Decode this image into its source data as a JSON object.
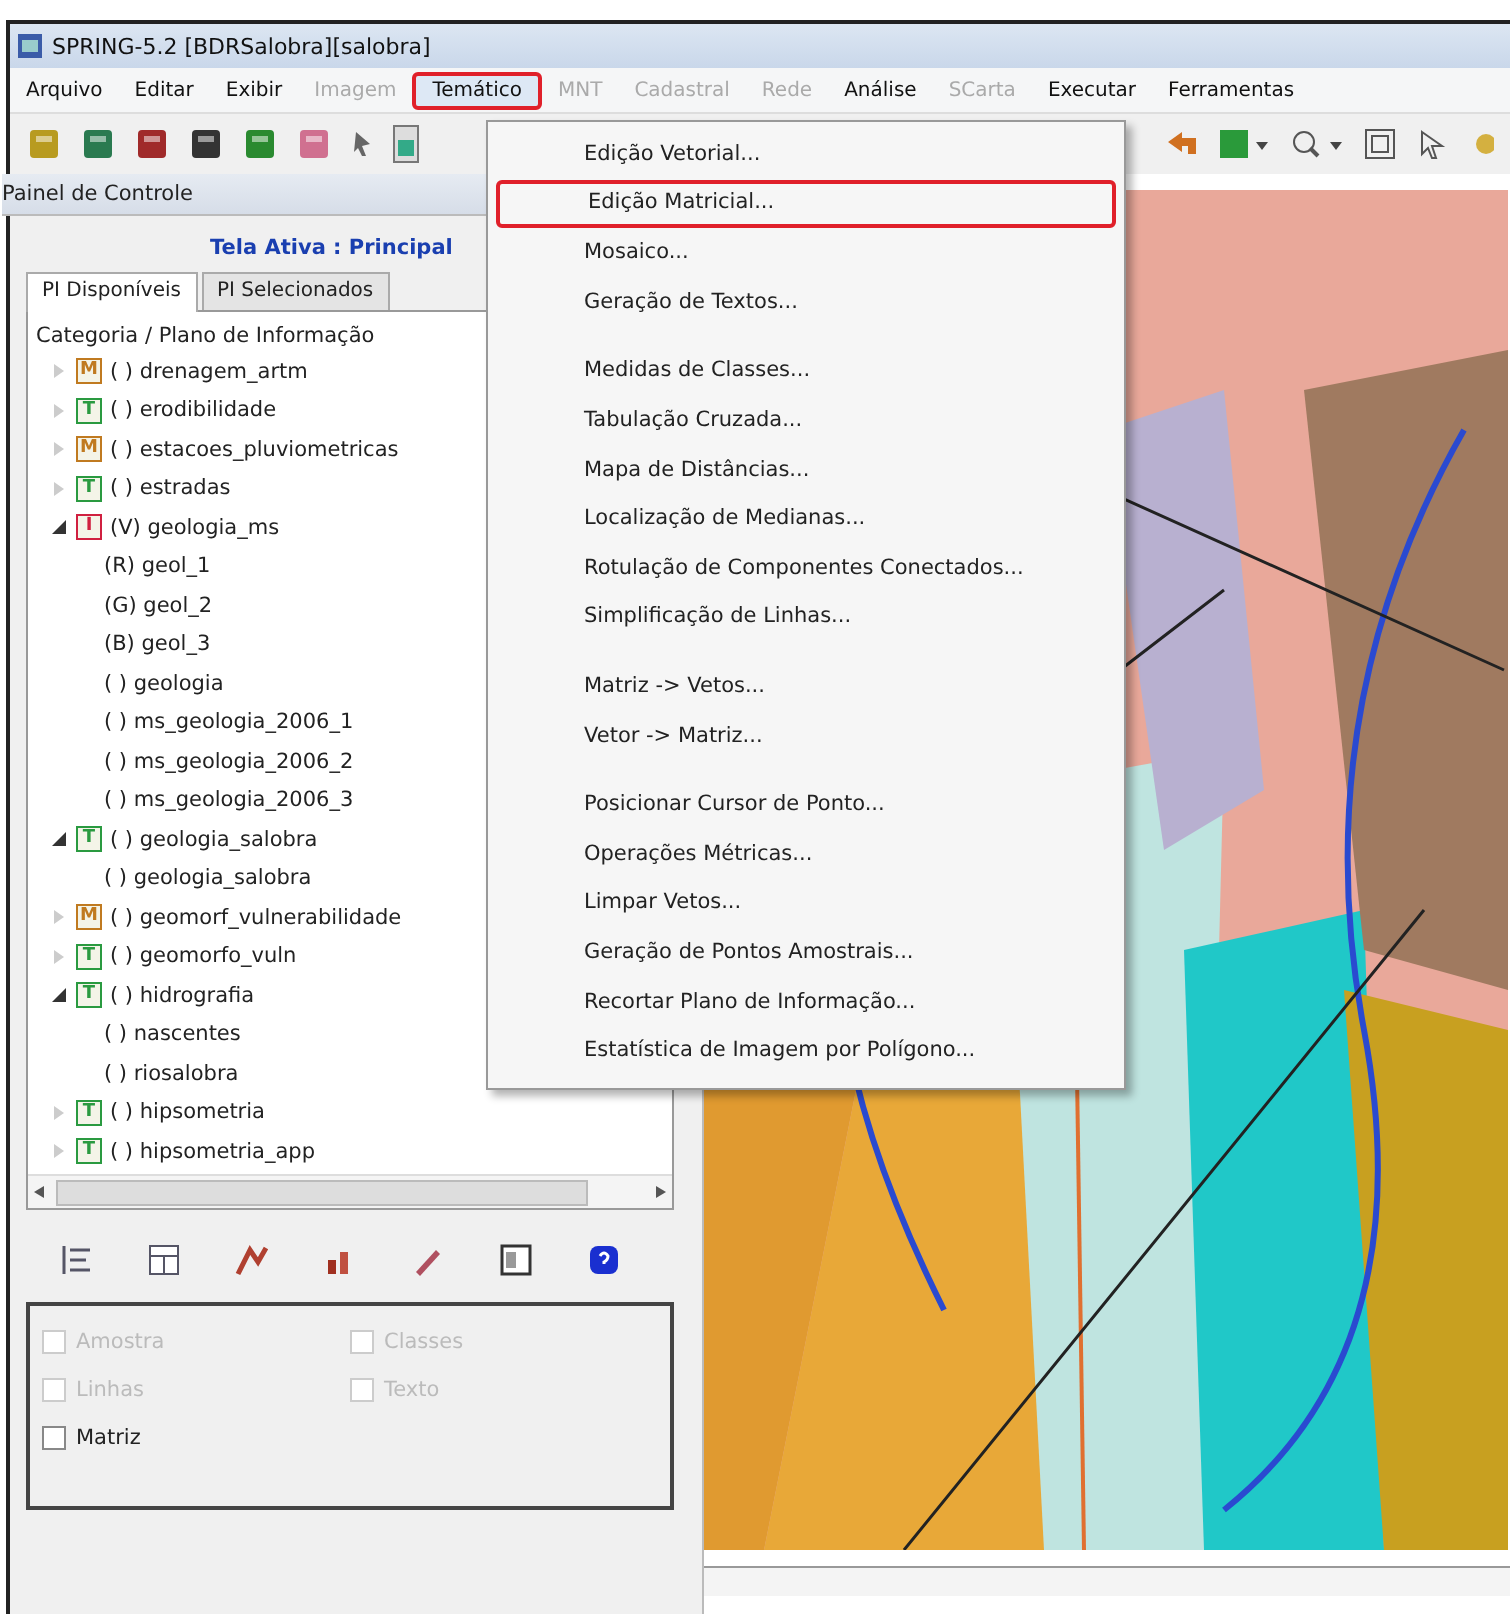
{
  "window": {
    "title": "SPRING-5.2 [BDRSalobra][salobra]"
  },
  "menu_bar": [
    {
      "label": "Arquivo",
      "disabled": false,
      "highlighted": false
    },
    {
      "label": "Editar",
      "disabled": false,
      "highlighted": false
    },
    {
      "label": "Exibir",
      "disabled": false,
      "highlighted": false
    },
    {
      "label": "Imagem",
      "disabled": true,
      "highlighted": false
    },
    {
      "label": "Temático",
      "disabled": false,
      "highlighted": true
    },
    {
      "label": "MNT",
      "disabled": true,
      "highlighted": false
    },
    {
      "label": "Cadastral",
      "disabled": true,
      "highlighted": false
    },
    {
      "label": "Rede",
      "disabled": true,
      "highlighted": false
    },
    {
      "label": "Análise",
      "disabled": false,
      "highlighted": false
    },
    {
      "label": "SCarta",
      "disabled": true,
      "highlighted": false
    },
    {
      "label": "Executar",
      "disabled": false,
      "highlighted": false
    },
    {
      "label": "Ferramentas",
      "disabled": false,
      "highlighted": false
    }
  ],
  "control_panel": {
    "title": "Painel de Controle",
    "active_screen": "Tela Ativa : Principal",
    "tabs": [
      {
        "label": "PI Disponíveis",
        "selected": true
      },
      {
        "label": "PI Selecionados",
        "selected": false
      }
    ],
    "tree_header": "Categoria / Plano de Informação",
    "tree": [
      {
        "label": "( ) drenagem_artm",
        "icon": {
          "letter": "M",
          "color": "#c07a20"
        },
        "expanded": false
      },
      {
        "label": "( ) erodibilidade",
        "icon": {
          "letter": "T",
          "color": "#2a9a40"
        },
        "expanded": false
      },
      {
        "label": "( ) estacoes_pluviometricas",
        "icon": {
          "letter": "M",
          "color": "#c07a20"
        },
        "expanded": false
      },
      {
        "label": "( ) estradas",
        "icon": {
          "letter": "T",
          "color": "#2a9a40"
        },
        "expanded": false
      },
      {
        "label": "(V) geologia_ms",
        "icon": {
          "letter": "I",
          "color": "#d02040"
        },
        "expanded": true,
        "children": [
          {
            "label": "(R) geol_1"
          },
          {
            "label": "(G) geol_2"
          },
          {
            "label": "(B) geol_3"
          },
          {
            "label": "( ) geologia"
          },
          {
            "label": "( ) ms_geologia_2006_1"
          },
          {
            "label": "( ) ms_geologia_2006_2"
          },
          {
            "label": "( ) ms_geologia_2006_3"
          }
        ]
      },
      {
        "label": "( ) geologia_salobra",
        "icon": {
          "letter": "T",
          "color": "#2a9a40"
        },
        "expanded": true,
        "children": [
          {
            "label": "( ) geologia_salobra"
          }
        ]
      },
      {
        "label": "( ) geomorf_vulnerabilidade",
        "icon": {
          "letter": "M",
          "color": "#c07a20"
        },
        "expanded": false
      },
      {
        "label": "( ) geomorfo_vuln",
        "icon": {
          "letter": "T",
          "color": "#2a9a40"
        },
        "expanded": false
      },
      {
        "label": "( ) hidrografia",
        "icon": {
          "letter": "T",
          "color": "#2a9a40"
        },
        "expanded": true,
        "children": [
          {
            "label": "( ) nascentes"
          },
          {
            "label": "( ) riosalobra"
          }
        ]
      },
      {
        "label": "( ) hipsometria",
        "icon": {
          "letter": "T",
          "color": "#2a9a40"
        },
        "expanded": false
      },
      {
        "label": "( ) hipsometria_app",
        "icon": {
          "letter": "T",
          "color": "#2a9a40"
        },
        "expanded": false
      }
    ],
    "checkboxes": [
      {
        "label": "Amostra",
        "checked": false,
        "disabled": true
      },
      {
        "label": "Classes",
        "checked": false,
        "disabled": true
      },
      {
        "label": "Linhas",
        "checked": false,
        "disabled": true
      },
      {
        "label": "Texto",
        "checked": false,
        "disabled": true
      },
      {
        "label": "Matriz",
        "checked": false,
        "disabled": false
      }
    ]
  },
  "dropdown": {
    "groups": [
      [
        {
          "label": "Edição Vetorial...",
          "highlighted": false
        },
        {
          "label": "Edição Matricial...",
          "highlighted": true
        },
        {
          "label": "Mosaico...",
          "highlighted": false
        },
        {
          "label": "Geração de Textos...",
          "highlighted": false
        }
      ],
      [
        {
          "label": "Medidas de Classes...",
          "highlighted": false
        },
        {
          "label": "Tabulação Cruzada...",
          "highlighted": false
        },
        {
          "label": "Mapa de Distâncias...",
          "highlighted": false
        },
        {
          "label": "Localização de Medianas...",
          "highlighted": false
        },
        {
          "label": "Rotulação de Componentes Conectados...",
          "highlighted": false
        },
        {
          "label": "Simplificação de Linhas...",
          "highlighted": false
        }
      ],
      [
        {
          "label": "Matriz -> Vetos...",
          "highlighted": false
        },
        {
          "label": "Vetor -> Matriz...",
          "highlighted": false
        }
      ],
      [
        {
          "label": "Posicionar Cursor de Ponto...",
          "highlighted": false
        },
        {
          "label": "Operações Métricas...",
          "highlighted": false
        },
        {
          "label": "Limpar Vetos...",
          "highlighted": false
        },
        {
          "label": "Geração de Pontos Amostrais...",
          "highlighted": false
        },
        {
          "label": "Recortar Plano de Informação...",
          "highlighted": false
        },
        {
          "label": "Estatística de Imagem por Polígono...",
          "highlighted": false
        }
      ]
    ]
  }
}
